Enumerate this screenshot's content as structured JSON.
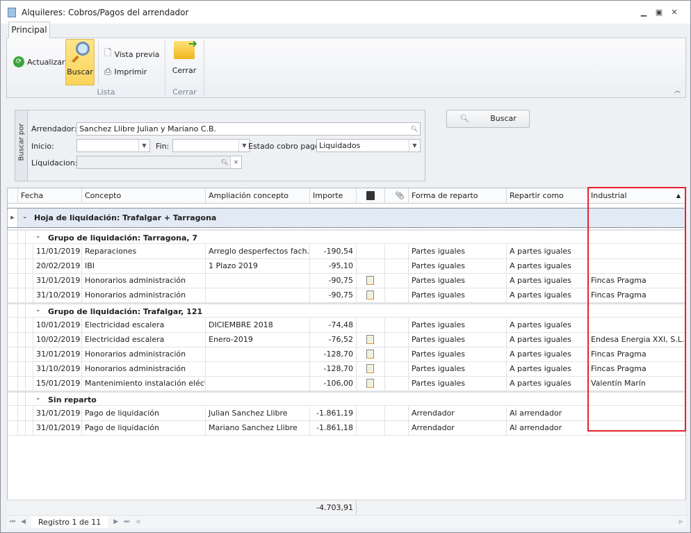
{
  "window": {
    "title": "Alquileres: Cobros/Pagos del arrendador"
  },
  "ribbon": {
    "tab": "Principal",
    "actualizar": "Actualizar",
    "buscar": "Buscar",
    "vista_previa": "Vista previa",
    "imprimir": "Imprimir",
    "cerrar": "Cerrar",
    "group_lista": "Lista",
    "group_cerrar": "Cerrar"
  },
  "filter": {
    "legend": "Buscar por",
    "arrendador_label": "Arrendador:",
    "arrendador_value": "Sanchez Llibre Julian y Mariano C.B.",
    "inicio_label": "Inicio:",
    "inicio_value": "",
    "fin_label": "Fin:",
    "fin_value": "",
    "estado_label": "Estado cobro pago:",
    "estado_value": "Liquidados",
    "liquidacion_label": "Liquidacion:",
    "liquidacion_value": "",
    "buscar_button": "Buscar"
  },
  "grid": {
    "columns": [
      "Fecha",
      "Concepto",
      "Ampliación concepto",
      "Importe",
      "",
      "",
      "Forma de reparto",
      "Repartir como",
      "Industrial"
    ],
    "sort_column": "Industrial",
    "top_group": "Hoja de liquidación: Trafalgar + Tarragona",
    "groups": [
      {
        "title": "Grupo de liquidación: Tarragona, 7",
        "rows": [
          [
            "11/01/2019",
            "Reparaciones",
            "Arreglo desperfectos fach...",
            "-190,54",
            false,
            "Partes iguales",
            "A partes iguales",
            ""
          ],
          [
            "20/02/2019",
            "IBI",
            "1 Plazo 2019",
            "-95,10",
            false,
            "Partes iguales",
            "A partes iguales",
            ""
          ],
          [
            "31/01/2019",
            "Honorarios administración",
            "",
            "-90,75",
            true,
            "Partes iguales",
            "A partes iguales",
            "Fincas Pragma"
          ],
          [
            "31/10/2019",
            "Honorarios administración",
            "",
            "-90,75",
            true,
            "Partes iguales",
            "A partes iguales",
            "Fincas Pragma"
          ]
        ]
      },
      {
        "title": "Grupo de liquidación: Trafalgar, 121",
        "rows": [
          [
            "10/01/2019",
            "Electricidad escalera",
            "DICIEMBRE 2018",
            "-74,48",
            false,
            "Partes iguales",
            "A partes iguales",
            ""
          ],
          [
            "10/02/2019",
            "Electricidad escalera",
            "Enero-2019",
            "-76,52",
            true,
            "Partes iguales",
            "A partes iguales",
            "Endesa Energia XXI, S.L.U."
          ],
          [
            "31/01/2019",
            "Honorarios administración",
            "",
            "-128,70",
            true,
            "Partes iguales",
            "A partes iguales",
            "Fincas Pragma"
          ],
          [
            "31/10/2019",
            "Honorarios administración",
            "",
            "-128,70",
            true,
            "Partes iguales",
            "A partes iguales",
            "Fincas Pragma"
          ],
          [
            "15/01/2019",
            "Mantenimiento instalación eléctrica",
            "",
            "-106,00",
            true,
            "Partes iguales",
            "A partes iguales",
            "Valentín Marín"
          ]
        ]
      },
      {
        "title": "Sin reparto",
        "rows": [
          [
            "31/01/2019",
            "Pago de liquidación",
            "Julian Sanchez Llibre",
            "-1.861,19",
            false,
            "Arrendador",
            "Al arrendador",
            ""
          ],
          [
            "31/01/2019",
            "Pago de liquidación",
            "Mariano Sanchez Llibre",
            "-1.861,18",
            false,
            "Arrendador",
            "Al arrendador",
            ""
          ]
        ]
      }
    ],
    "total_importe": "-4.703,91",
    "navigator": "Registro 1 de 11"
  },
  "colors": {
    "highlight": "#e8202a",
    "group_band": "#e2ebf5",
    "buscar_active": "#fbd35a"
  }
}
